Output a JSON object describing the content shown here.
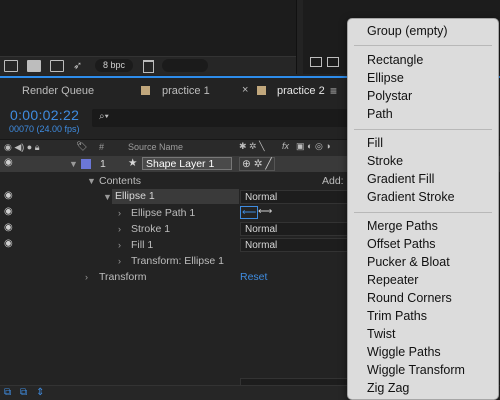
{
  "toolbar": {
    "bpc_label": "8 bpc"
  },
  "tabs": [
    {
      "label": "Render Queue"
    },
    {
      "label": "practice 1"
    },
    {
      "label": "practice 2"
    }
  ],
  "tab_close_glyph": "×",
  "tab_menu_glyph": "≡",
  "time": {
    "timecode": "0:00:02:22",
    "frames": "00070 (24.00 fps)"
  },
  "header": {
    "number": "#",
    "source_name": "Source Name",
    "fx_label": "fx"
  },
  "layer": {
    "number": "1",
    "name": "Shape Layer 1"
  },
  "tree": {
    "contents": "Contents",
    "add_label": "Add:",
    "ellipse": "Ellipse 1",
    "ellipse_blend": "Normal",
    "ellipse_path": "Ellipse Path 1",
    "stroke": "Stroke 1",
    "stroke_blend": "Normal",
    "fill": "Fill 1",
    "fill_blend": "Normal",
    "transform_ellipse": "Transform: Ellipse 1",
    "transform": "Transform",
    "reset": "Reset"
  },
  "menu": {
    "group": "Group (empty)",
    "items1": [
      "Rectangle",
      "Ellipse",
      "Polystar",
      "Path"
    ],
    "items2": [
      "Fill",
      "Stroke",
      "Gradient Fill",
      "Gradient Stroke"
    ],
    "items3": [
      "Merge Paths",
      "Offset Paths",
      "Pucker & Bloat",
      "Repeater",
      "Round Corners",
      "Trim Paths",
      "Twist",
      "Wiggle Paths",
      "Wiggle Transform",
      "Zig Zag"
    ]
  },
  "colors": {
    "accent": "#2d8ceb",
    "layer_label": "#6b77d8",
    "tab_swatch": "#c1a77c"
  }
}
